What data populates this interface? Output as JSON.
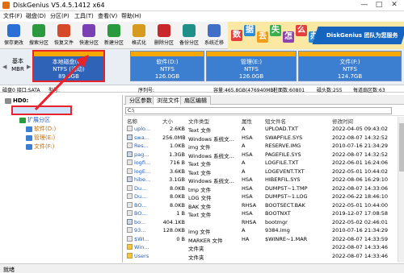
{
  "window": {
    "title": "DiskGenius V5.4.5.1412 x64"
  },
  "menu": [
    "文件(F)",
    "磁盘(D)",
    "分区(P)",
    "工具(T)",
    "查看(V)",
    "帮助(H)"
  ],
  "toolbar": [
    {
      "label": "保存更改",
      "color": "#2a6fd6"
    },
    {
      "label": "搜索分区",
      "color": "#2b9a3e"
    },
    {
      "label": "恢复文件",
      "color": "#d6492a"
    },
    {
      "label": "快速分区",
      "color": "#7b3fb4"
    },
    {
      "label": "新建分区",
      "color": "#2b9a3e"
    },
    {
      "label": "格式化",
      "color": "#d69a1e"
    },
    {
      "label": "删除分区",
      "color": "#c8282b"
    },
    {
      "label": "备份分区",
      "color": "#1f8f8a"
    },
    {
      "label": "系统迁移",
      "color": "#3f6fc6"
    }
  ],
  "banner": {
    "glyphs": [
      "数",
      "据",
      "丢",
      "失",
      "怎",
      "么",
      "办"
    ],
    "text": "DiskGenius 团队为您服务"
  },
  "disk_map": {
    "basic_label": [
      "基本",
      "MBR"
    ],
    "partitions": [
      {
        "name": "本地磁盘(C:)",
        "fs": "NTFS (活动)",
        "size": "89.0GB",
        "selected": true
      },
      {
        "name": "软件(D:)",
        "fs": "NTFS",
        "size": "126.0GB",
        "selected": false
      },
      {
        "name": "管理(E:)",
        "fs": "NTFS",
        "size": "126.0GB",
        "selected": false
      },
      {
        "name": "文件(F:)",
        "fs": "NTFS",
        "size": "124.7GB",
        "selected": false
      }
    ]
  },
  "info_bar": {
    "interface": "磁盘0 接口:SATA",
    "model": "型号:",
    "serial": "序列号:",
    "capacity": "容量:465.8GB(476940MB)",
    "cylinders": "柱面数:60801",
    "heads": "磁头数:255",
    "sectors": "每道扇区数:63"
  },
  "tree": {
    "root": "HD0:",
    "items": [
      {
        "label": "本地磁盘(C:)",
        "level": 1,
        "icon": "drive",
        "highlight": true
      },
      {
        "label": "扩展分区",
        "level": 1,
        "icon": "extended",
        "highlight": false
      },
      {
        "label": "软件(D:)",
        "level": 2,
        "icon": "drive",
        "highlight": false
      },
      {
        "label": "管理(E:)",
        "level": 2,
        "icon": "drive",
        "highlight": false
      },
      {
        "label": "文件(F:)",
        "level": 2,
        "icon": "drive",
        "highlight": false
      }
    ]
  },
  "tabs": [
    "分区参数",
    "浏览文件",
    "扇区编辑"
  ],
  "active_tab": 1,
  "path": "C:\\",
  "columns": [
    "名称",
    "大小",
    "文件类型",
    "属性",
    "短文件名",
    "修改时间"
  ],
  "files": [
    {
      "name": "uplo...",
      "size": "2.6KB",
      "type": "Text 文件",
      "attr": "A",
      "short": "UPLOAD.TXT",
      "modified": "2022-04-05 09:43:02",
      "icon": "file"
    },
    {
      "name": "swa...",
      "size": "256.0MB",
      "type": "Windows 系统文...",
      "attr": "HSA",
      "short": "SWAPFILE.SYS",
      "modified": "2022-08-07 14:32:52",
      "icon": "sys"
    },
    {
      "name": "Res...",
      "size": "1.0KB",
      "type": "img 文件",
      "attr": "A",
      "short": "RESERVE.IMG",
      "modified": "2010-07-16 21:34:29",
      "icon": "file"
    },
    {
      "name": "pag...",
      "size": "1.3GB",
      "type": "Windows 系统文...",
      "attr": "HSA",
      "short": "PAGEFILE.SYS",
      "modified": "2022-08-07 14:32:52",
      "icon": "sys"
    },
    {
      "name": "logfi...",
      "size": "716 B",
      "type": "Text 文件",
      "attr": "A",
      "short": "LOGFILE.TXT",
      "modified": "2022-06-01 16:24:06",
      "icon": "file"
    },
    {
      "name": "logE...",
      "size": "3.6KB",
      "type": "Text 文件",
      "attr": "A",
      "short": "LOGEVENT.TXT",
      "modified": "2022-05-01 10:44:02",
      "icon": "file"
    },
    {
      "name": "hibe...",
      "size": "3.1GB",
      "type": "Windows 系统文...",
      "attr": "HSA",
      "short": "HIBERFIL.SYS",
      "modified": "2022-08-06 16:29:10",
      "icon": "sys"
    },
    {
      "name": "Du...",
      "size": "8.0KB",
      "type": "tmp 文件",
      "attr": "HSA",
      "short": "DUMPST~1.TMP",
      "modified": "2022-08-07 14:33:06",
      "icon": "file"
    },
    {
      "name": "Du...",
      "size": "8.0KB",
      "type": "LOG 文件",
      "attr": "HSA",
      "short": "DUMPST~1.LOG",
      "modified": "2022-06-22 18:46:10",
      "icon": "file"
    },
    {
      "name": "BO...",
      "size": "8.0KB",
      "type": "BAK 文件",
      "attr": "RHSA",
      "short": "BOOTSECT.BAK",
      "modified": "2022-05-01 10:44:00",
      "icon": "file"
    },
    {
      "name": "BO...",
      "size": "1 B",
      "type": "Text 文件",
      "attr": "HSA",
      "short": "BOOTNXT",
      "modified": "2019-12-07 17:08:58",
      "icon": "file"
    },
    {
      "name": "bo...",
      "size": "404.1KB",
      "type": "",
      "attr": "RHSA",
      "short": "bootmgr",
      "modified": "2022-05-02 02:46:01",
      "icon": "sys"
    },
    {
      "name": "93...",
      "size": "128.0KB",
      "type": "img 文件",
      "attr": "A",
      "short": "9384.img",
      "modified": "2010-07-16 21:34:29",
      "icon": "file"
    },
    {
      "name": "$WI...",
      "size": "0 B",
      "type": "MARKER 文件",
      "attr": "HA",
      "short": "$WINRE~1.MAR",
      "modified": "2022-08-07 14:33:59",
      "icon": "file"
    },
    {
      "name": "Win...",
      "size": "",
      "type": "文件夹",
      "attr": "",
      "short": "",
      "modified": "2022-08-07 14:33:46",
      "icon": "folder"
    },
    {
      "name": "Users",
      "size": "",
      "type": "文件夹",
      "attr": "",
      "short": "",
      "modified": "2022-08-07 14:33:46",
      "icon": "folder"
    }
  ],
  "status": "就绪"
}
